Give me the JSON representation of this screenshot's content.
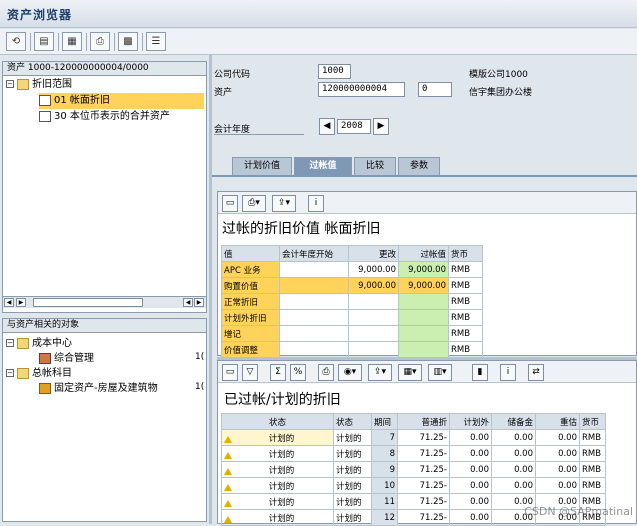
{
  "window": {
    "title": "资产浏览器"
  },
  "tree1": {
    "header": "资产 1000-120000000004/0000",
    "items": [
      {
        "label": "折旧范围"
      },
      {
        "label": "01 帐面折旧"
      },
      {
        "label": "30 本位币表示的合并资产"
      }
    ]
  },
  "tree2": {
    "header": "与资产相关的对象",
    "items": [
      {
        "label": "成本中心"
      },
      {
        "label": "综合管理",
        "col": "1("
      },
      {
        "label": "总帐科目"
      },
      {
        "label": "固定资产-房屋及建筑物",
        "col": "1("
      }
    ]
  },
  "form": {
    "company_code_label": "公司代码",
    "company_code_value": "1000",
    "company_name": "模版公司1000",
    "asset_label": "资产",
    "asset_value": "120000000004",
    "asset_sub": "0",
    "asset_name": "信宇集团办公楼",
    "fiscal_year_label": "会计年度",
    "fiscal_year_value": "2008",
    "prev": "◀",
    "next": "▶"
  },
  "tabs": [
    {
      "label": "计划价值"
    },
    {
      "label": "过帐值"
    },
    {
      "label": "比较"
    },
    {
      "label": "参数"
    }
  ],
  "grid1": {
    "title": "过帐的折旧价值 帐面折旧",
    "headers": [
      "值",
      "会计年度开始",
      "更改",
      "过帐值",
      "货币"
    ],
    "rows": [
      [
        "APC 业务",
        "",
        "9,000.00",
        "9,000.00",
        "RMB"
      ],
      [
        "购置价值",
        "",
        "9,000.00",
        "9,000.00",
        "RMB"
      ],
      [
        "正常折旧",
        "",
        "",
        "",
        "RMB"
      ],
      [
        "计划外折旧",
        "",
        "",
        "",
        "RMB"
      ],
      [
        "增记",
        "",
        "",
        "",
        "RMB"
      ],
      [
        "价值调整",
        "",
        "",
        "",
        "RMB"
      ]
    ]
  },
  "grid2": {
    "title": "已过帐/计划的折旧",
    "headers": [
      "状态",
      "状态",
      "期间",
      "普通折",
      "计划外",
      "储备金",
      "重估",
      "货币"
    ],
    "rows": [
      [
        "计划的",
        "计划的",
        "7",
        "71.25-",
        "0.00",
        "0.00",
        "0.00",
        "RMB"
      ],
      [
        "计划的",
        "计划的",
        "8",
        "71.25-",
        "0.00",
        "0.00",
        "0.00",
        "RMB"
      ],
      [
        "计划的",
        "计划的",
        "9",
        "71.25-",
        "0.00",
        "0.00",
        "0.00",
        "RMB"
      ],
      [
        "计划的",
        "计划的",
        "10",
        "71.25-",
        "0.00",
        "0.00",
        "0.00",
        "RMB"
      ],
      [
        "计划的",
        "计划的",
        "11",
        "71.25-",
        "0.00",
        "0.00",
        "0.00",
        "RMB"
      ],
      [
        "计划的",
        "计划的",
        "12",
        "71.25-",
        "0.00",
        "0.00",
        "0.00",
        "RMB"
      ]
    ]
  },
  "watermark": "CSDN @SAPmatinal"
}
